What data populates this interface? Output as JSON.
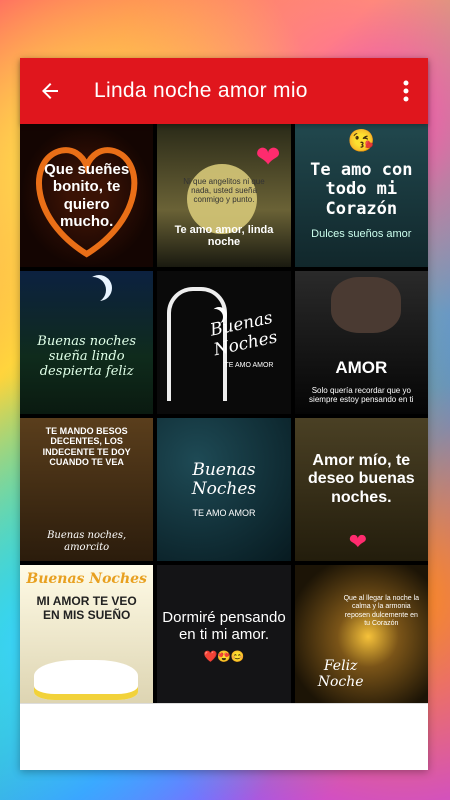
{
  "appbar": {
    "title": "Linda noche amor mio",
    "back_icon": "arrow-left-icon",
    "more_icon": "more-vert-icon",
    "color": "#e0161d"
  },
  "tiles": [
    {
      "text": "Que sueñes bonito, te quiero mucho.",
      "bg": "#1a0a05",
      "accent": "#ff7a1a"
    },
    {
      "text": "Ni que angelitos ni que nada, usted sueña conmigo y punto.",
      "sub": "Te amo amor, linda noche",
      "bg": "#4a4a2a"
    },
    {
      "text": "Te amo con todo mi Corazón",
      "sub": "Dulces sueños amor",
      "bg": "#1c3a40"
    },
    {
      "text": "Buenas noches sueña lindo despierta feliz",
      "bg": "#0f2b1c"
    },
    {
      "text": "Buenas Noches",
      "sub": "TE AMO AMOR",
      "bg": "#0a0a0a"
    },
    {
      "text": "AMOR",
      "sub": "Solo quería recordar que yo siempre estoy pensando en ti",
      "bg": "#101010"
    },
    {
      "text": "TE MANDO BESOS DECENTES, LOS INDECENTE TE DOY CUANDO TE VEA",
      "sub": "Buenas noches, amorcito",
      "bg": "#3b2814"
    },
    {
      "text": "Buenas Noches",
      "sub": "TE AMO AMOR",
      "bg": "#0d2a33"
    },
    {
      "text": "Amor mío, te deseo buenas noches.",
      "bg": "#3a3218"
    },
    {
      "text": "Buenas Noches",
      "sub": "MI AMOR TE VEO EN MIS SUEÑO",
      "bg": "#f2e6c8"
    },
    {
      "text": "Dormiré pensando en ti mi amor.",
      "sub": "❤️😍😊",
      "bg": "#141416"
    },
    {
      "text": "Que al llegar la noche la calma y la armonia reposen dulcemente en tu Corazón",
      "sub": "Feliz Noche",
      "bg": "#2b1f0c"
    }
  ],
  "banner": {
    "text": ""
  }
}
